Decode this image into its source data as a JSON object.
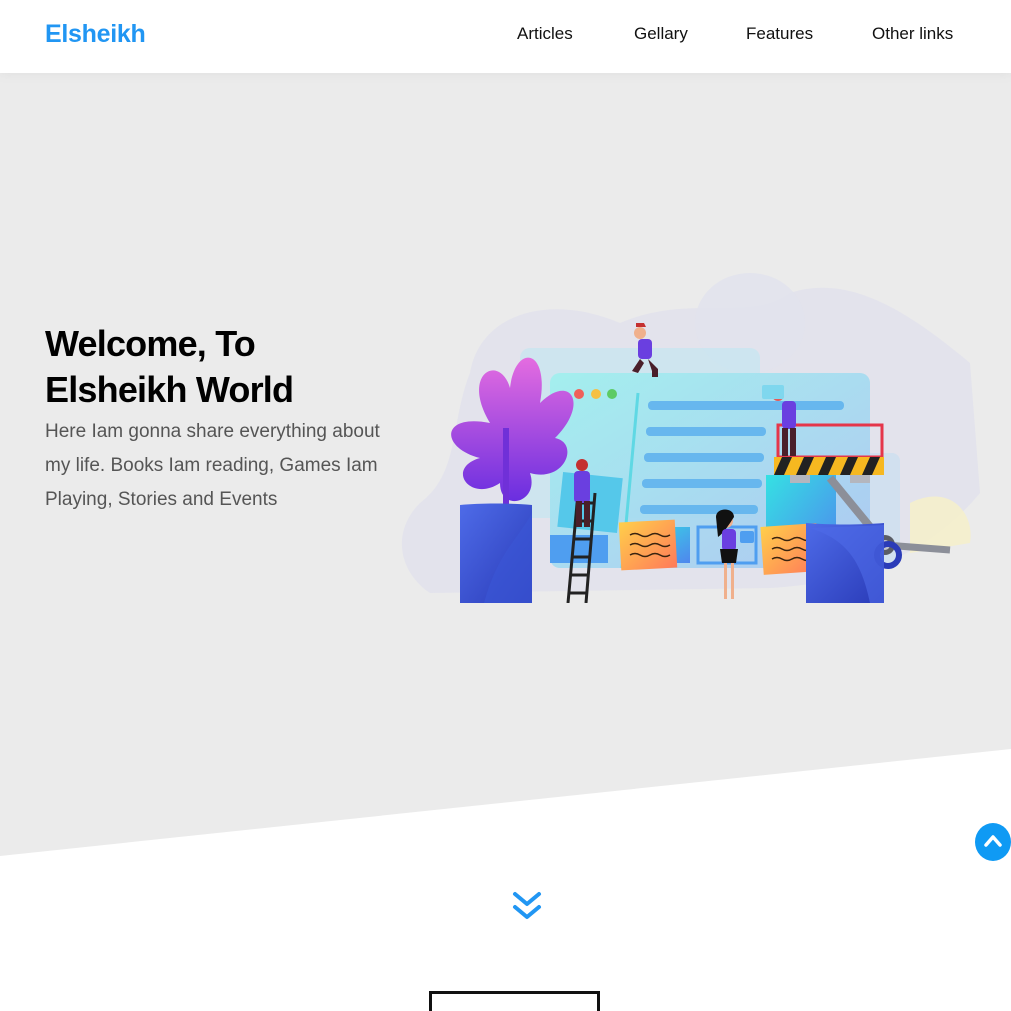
{
  "header": {
    "logo": "Elsheikh",
    "nav": [
      {
        "label": "Articles"
      },
      {
        "label": "Gellary"
      },
      {
        "label": "Features"
      },
      {
        "label": "Other links"
      }
    ]
  },
  "landing": {
    "title_line1": "Welcome, To",
    "title_line2": "Elsheikh World",
    "text": "Here Iam gonna share everything about my life. Books Iam reading, Games Iam Playing, Stories and Events"
  },
  "icons": {
    "go_down": "double-chevron-down-icon",
    "scroll_up": "chevron-up-icon"
  },
  "colors": {
    "brand": "#2196f3",
    "landing_bg": "#ebebeb",
    "scroll_up_bg": "#0f9af4"
  }
}
